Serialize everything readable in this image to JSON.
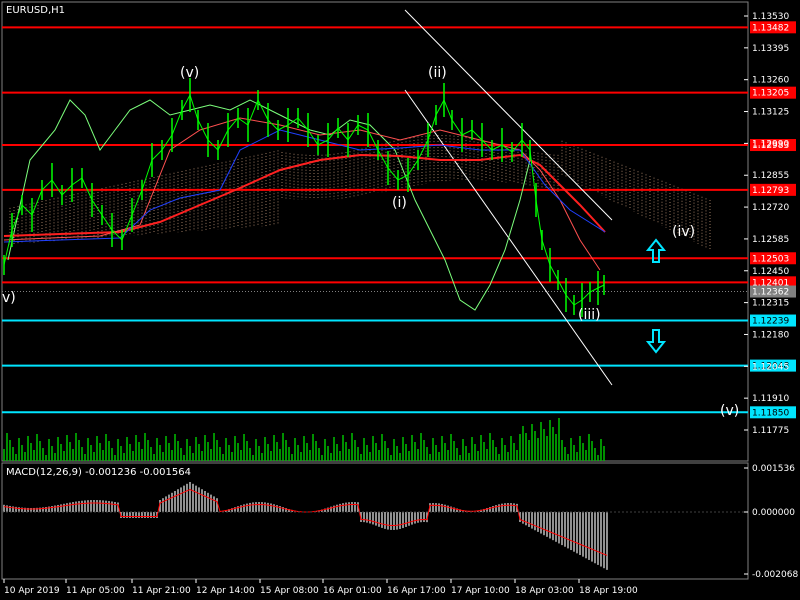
{
  "symbol_title": "EURUSD,H1",
  "macd_title": "MACD(12,26,9) -0.001236 -0.001564",
  "colors": {
    "background": "#000000",
    "grid": "#2f2f2f",
    "resistance": "#ff0000",
    "support": "#00e5ff",
    "candle": "#00ff00",
    "ma_red": "#ff2020",
    "ma_blue": "#2040ff",
    "channel": "#ffffff",
    "cloud": "#ffc8a0",
    "volume": "#00c000",
    "macd_hist": "#c0c0c0",
    "macd_signal": "#ff0000",
    "arrow": "#00e5ff",
    "tag_current": "#808080"
  },
  "price_scale": [
    "1.13530",
    "1.13395",
    "1.13260",
    "1.13125",
    "1.12990",
    "1.12855",
    "1.12720",
    "1.12585",
    "1.12450",
    "1.12315",
    "1.12180",
    "1.12045",
    "1.11910",
    "1.11775"
  ],
  "horizontal_levels": [
    {
      "price": "1.13482",
      "kind": "resistance"
    },
    {
      "price": "1.13205",
      "kind": "resistance"
    },
    {
      "price": "1.12983",
      "kind": "resistance"
    },
    {
      "price": "1.12793",
      "kind": "resistance"
    },
    {
      "price": "1.12503",
      "kind": "resistance"
    },
    {
      "price": "1.12401",
      "kind": "resistance"
    },
    {
      "price": "1.12239",
      "kind": "support"
    },
    {
      "price": "1.12048",
      "kind": "support"
    },
    {
      "price": "1.11850",
      "kind": "support"
    }
  ],
  "current_price": "1.12362",
  "macd_scale": [
    "0.001536",
    "0.000000",
    "-0.002068"
  ],
  "time_axis": [
    "10 Apr 2019",
    "11 Apr 05:00",
    "11 Apr 21:00",
    "12 Apr 14:00",
    "15 Apr 08:00",
    "16 Apr 01:00",
    "16 Apr 17:00",
    "17 Apr 10:00",
    "18 Apr 03:00",
    "18 Apr 19:00"
  ],
  "wave_labels": [
    {
      "text": "(v)"
    },
    {
      "text": "(ii)"
    },
    {
      "text": "(i)"
    },
    {
      "text": "v)"
    },
    {
      "text": "(iii)"
    },
    {
      "text": "(iv)"
    },
    {
      "text": "(v)"
    }
  ],
  "arrows": [
    {
      "direction": "up",
      "icon": "arrow-up-icon"
    },
    {
      "direction": "down",
      "icon": "arrow-down-icon"
    }
  ]
}
